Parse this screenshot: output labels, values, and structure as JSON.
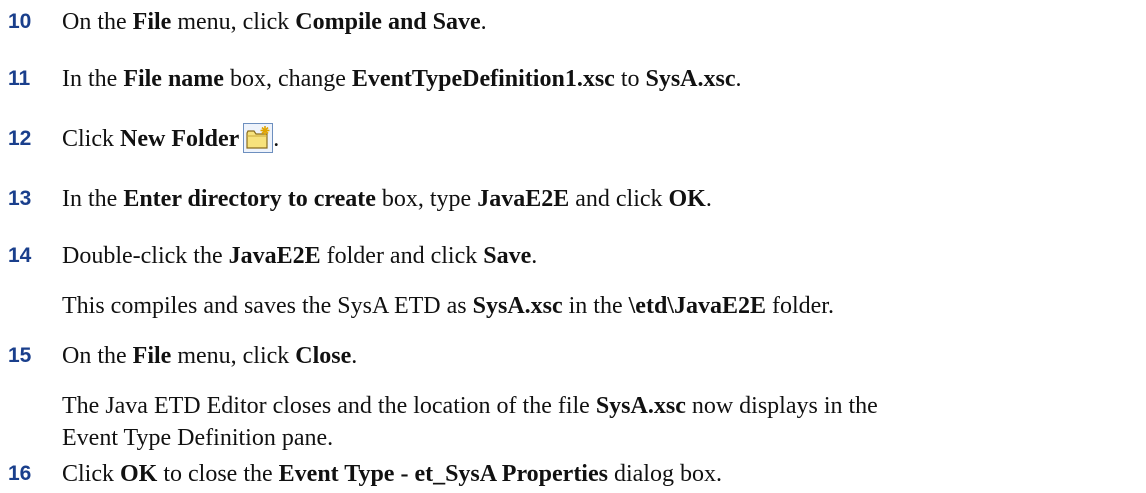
{
  "steps": [
    {
      "num": "10",
      "parts": [
        "On the ",
        "File",
        " menu, click ",
        "Compile and Save",
        "."
      ]
    },
    {
      "num": "11",
      "parts": [
        "In the ",
        "File name",
        " box, change ",
        "EventTypeDefinition1.xsc",
        " to ",
        "SysA.xsc",
        "."
      ]
    },
    {
      "num": "12",
      "parts": [
        "Click ",
        "New Folder",
        "."
      ],
      "icon": "new-folder-icon"
    },
    {
      "num": "13",
      "parts": [
        "In the ",
        "Enter directory to create",
        " box, type ",
        "JavaE2E",
        " and click ",
        "OK",
        "."
      ]
    },
    {
      "num": "14",
      "parts": [
        "Double-click the ",
        "JavaE2E",
        " folder and click ",
        "Save",
        "."
      ],
      "note": [
        "This compiles and saves the SysA ETD as ",
        "SysA.xsc",
        " in the ",
        "\\etd\\JavaE2E",
        " folder."
      ]
    },
    {
      "num": "15",
      "parts": [
        "On the ",
        "File",
        " menu, click ",
        "Close",
        "."
      ],
      "note1": [
        "The Java ETD Editor closes and the location of the file ",
        "SysA.xsc",
        " now displays in the"
      ],
      "note2": "Event Type Definition pane."
    },
    {
      "num": "16",
      "parts": [
        "Click ",
        "OK",
        " to close the ",
        "Event Type - et_SysA Properties",
        " dialog box."
      ]
    }
  ],
  "colors": {
    "step_number": "#1a3f8c",
    "text": "#111111"
  }
}
